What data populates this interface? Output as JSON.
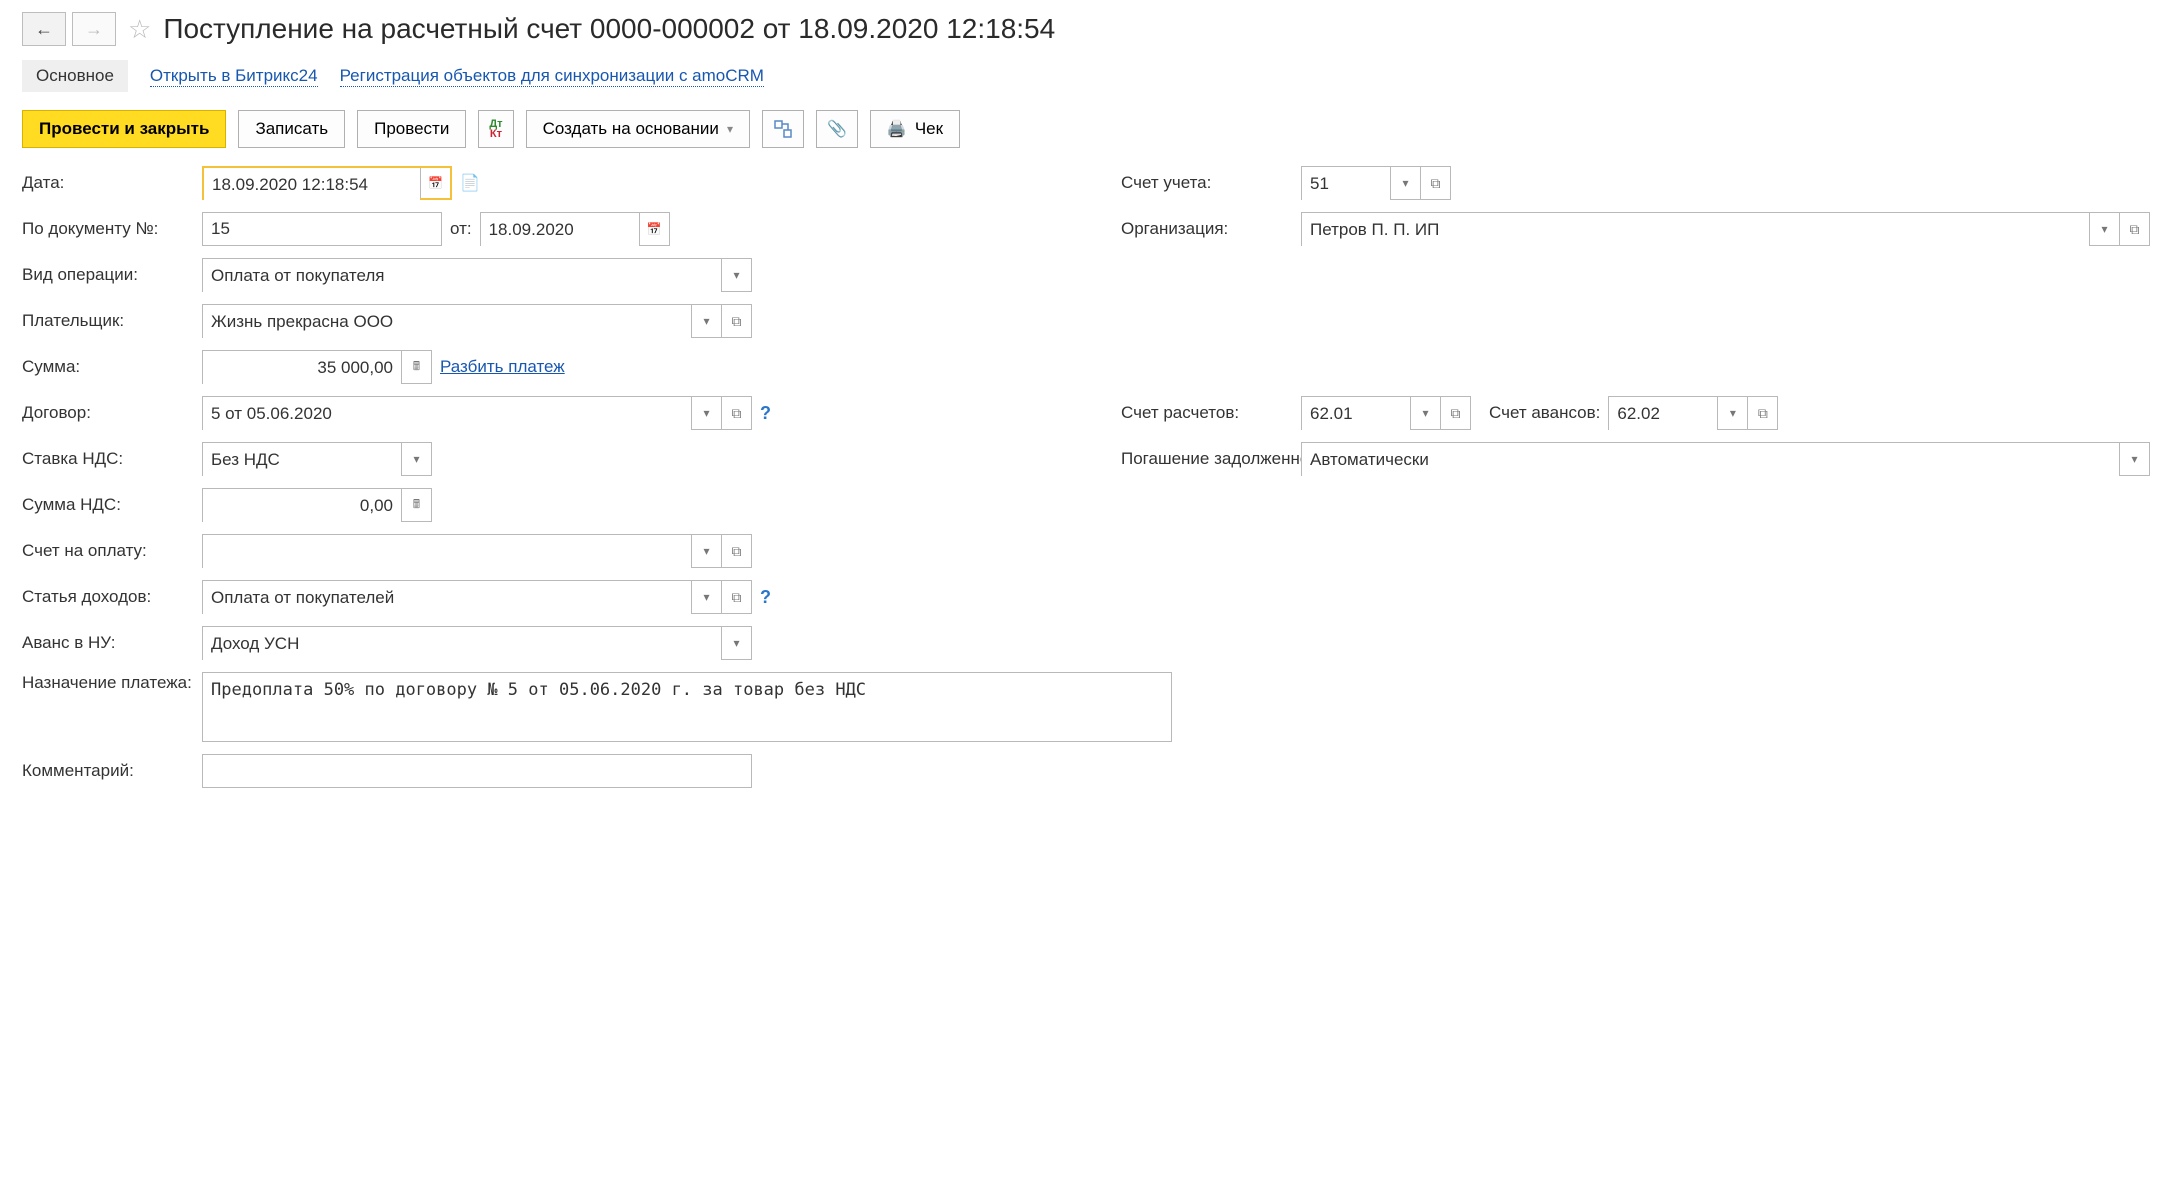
{
  "header": {
    "title": "Поступление на расчетный счет 0000-000002 от 18.09.2020 12:18:54"
  },
  "tabs": {
    "main": "Основное",
    "bitrix": "Открыть в Битрикс24",
    "amo": "Регистрация объектов для синхронизации с amoCRM"
  },
  "toolbar": {
    "post_close": "Провести и закрыть",
    "save": "Записать",
    "post": "Провести",
    "dt": "Дт",
    "kt": "Кт",
    "create_on": "Создать на основании",
    "check": "Чек"
  },
  "labels": {
    "date": "Дата:",
    "doc_no": "По документу №:",
    "from": "от:",
    "op_type": "Вид операции:",
    "payer": "Плательщик:",
    "sum": "Сумма:",
    "split": "Разбить платеж",
    "contract": "Договор:",
    "vat_rate": "Ставка НДС:",
    "vat_sum": "Сумма НДС:",
    "invoice": "Счет на оплату:",
    "income_item": "Статья доходов:",
    "advance_nu": "Аванс в НУ:",
    "purpose": "Назначение платежа:",
    "comment": "Комментарий:",
    "account": "Счет учета:",
    "org": "Организация:",
    "settle_acc": "Счет расчетов:",
    "advance_acc": "Счет авансов:",
    "debt": "Погашение задолженности:"
  },
  "values": {
    "date": "18.09.2020 12:18:54",
    "doc_no": "15",
    "doc_date": "18.09.2020",
    "op_type": "Оплата от покупателя",
    "payer": "Жизнь прекрасна ООО",
    "sum": "35 000,00",
    "contract": "5 от 05.06.2020",
    "vat_rate": "Без НДС",
    "vat_sum": "0,00",
    "invoice": "",
    "income_item": "Оплата от покупателей",
    "advance_nu": "Доход УСН",
    "purpose": "Предоплата 50% по договору № 5 от 05.06.2020 г. за товар без НДС",
    "comment": "",
    "account": "51",
    "org": "Петров П. П. ИП",
    "settle_acc": "62.01",
    "advance_acc": "62.02",
    "debt": "Автоматически"
  }
}
